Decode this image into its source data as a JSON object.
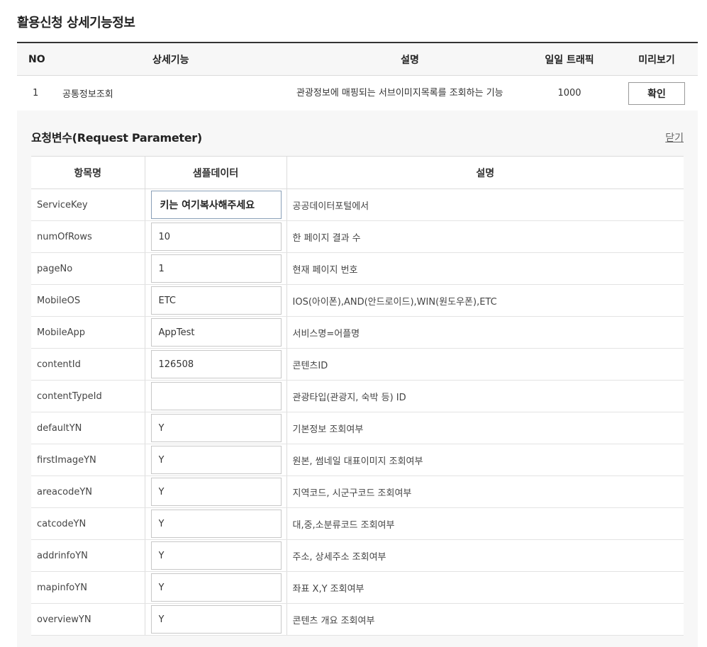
{
  "page": {
    "title": "활용신청 상세기능정보"
  },
  "main_table": {
    "headers": {
      "no": "NO",
      "func": "상세기능",
      "desc": "설명",
      "traffic": "일일 트래픽",
      "preview": "미리보기"
    },
    "row": {
      "no": "1",
      "func": "공통정보조회",
      "desc": "관광정보에 매핑되는 서브이미지목록를 조회하는 기능",
      "traffic": "1000",
      "button": "확인"
    }
  },
  "panel": {
    "title": "요청변수(Request Parameter)",
    "close": "닫기",
    "headers": {
      "name": "항목명",
      "sample": "샘플데이터",
      "desc": "설명"
    },
    "params": [
      {
        "name": "ServiceKey",
        "sample": "키는 여기복사해주세요",
        "desc": "공공데이터포털에서"
      },
      {
        "name": "numOfRows",
        "sample": "10",
        "desc": "한 페이지 결과 수"
      },
      {
        "name": "pageNo",
        "sample": "1",
        "desc": "현재 페이지 번호"
      },
      {
        "name": "MobileOS",
        "sample": "ETC",
        "desc": "IOS(아이폰),AND(안드로이드),WIN(원도우폰),ETC"
      },
      {
        "name": "MobileApp",
        "sample": "AppTest",
        "desc": "서비스명=어플명"
      },
      {
        "name": "contentId",
        "sample": "126508",
        "desc": "콘텐츠ID"
      },
      {
        "name": "contentTypeId",
        "sample": "",
        "desc": "관광타입(관광지, 숙박 등) ID"
      },
      {
        "name": "defaultYN",
        "sample": "Y",
        "desc": "기본정보 조회여부"
      },
      {
        "name": "firstImageYN",
        "sample": "Y",
        "desc": "원본, 썸네일 대표이미지 조회여부"
      },
      {
        "name": "areacodeYN",
        "sample": "Y",
        "desc": "지역코드, 시군구코드 조회여부"
      },
      {
        "name": "catcodeYN",
        "sample": "Y",
        "desc": "대,중,소분류코드 조회여부"
      },
      {
        "name": "addrinfoYN",
        "sample": "Y",
        "desc": "주소, 상세주소 조회여부"
      },
      {
        "name": "mapinfoYN",
        "sample": "Y",
        "desc": "좌표 X,Y 조회여부"
      },
      {
        "name": "overviewYN",
        "sample": "Y",
        "desc": "콘텐츠 개요 조회여부"
      }
    ]
  }
}
